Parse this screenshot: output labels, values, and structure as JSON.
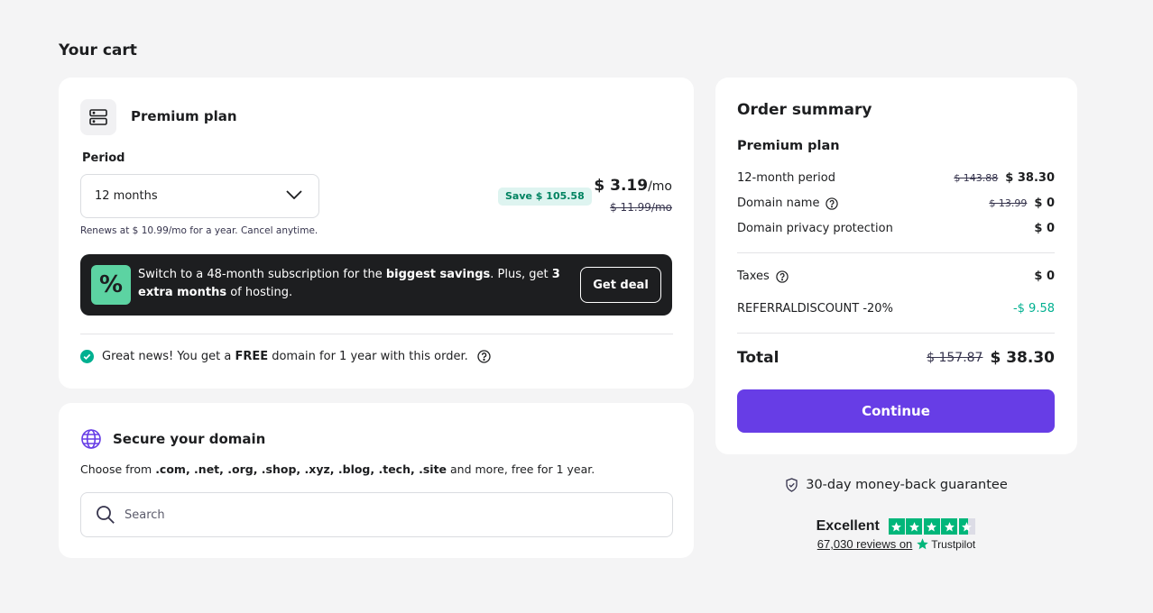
{
  "cart": {
    "title": "Your cart"
  },
  "plan": {
    "name": "Premium plan",
    "period_label": "Period",
    "period_value": "12 months",
    "save_badge": "Save $ 105.58",
    "price": "$ 3.19",
    "price_unit": "/mo",
    "old_price": "$ 11.99/mo",
    "renew_note": "Renews at $ 10.99/mo for a year. Cancel anytime."
  },
  "deal": {
    "percent_symbol": "%",
    "text_1": "Switch to a 48-month subscription for the ",
    "text_bold_1": "biggest savings",
    "text_2": ". Plus, get ",
    "text_bold_2": "3 extra months",
    "text_3": " of hosting.",
    "button_label": "Get deal"
  },
  "free_domain": {
    "text_1": "Great news! You get a ",
    "text_bold": "FREE",
    "text_2": " domain for 1 year with this order."
  },
  "domain": {
    "title": "Secure your domain",
    "desc_1": "Choose from ",
    "desc_bold": ".com, .net, .org, .shop, .xyz, .blog, .tech, .site",
    "desc_2": " and more, free for 1 year.",
    "search_placeholder": "Search"
  },
  "summary": {
    "title": "Order summary",
    "plan_name": "Premium plan",
    "rows": [
      {
        "label": "12-month period",
        "old": "$ 143.88",
        "value": "$ 38.30"
      },
      {
        "label": "Domain name",
        "old": "$ 13.99",
        "value": "$ 0"
      },
      {
        "label": "Domain privacy protection",
        "value": "$ 0"
      }
    ],
    "taxes_label": "Taxes",
    "taxes_value": "$ 0",
    "discount_label": "REFERRALDISCOUNT -20%",
    "discount_value": "-$ 9.58",
    "total_label": "Total",
    "total_old": "$ 157.87",
    "total_value": "$ 38.30",
    "continue_label": "Continue",
    "discount_color": "#00b090",
    "accent_color": "#673de6"
  },
  "guarantee": {
    "text": "30-day money-back guarantee"
  },
  "trustpilot": {
    "rating_word": "Excellent",
    "reviews": "67,030 reviews on",
    "brand": "Trustpilot",
    "stars": 4.5
  }
}
